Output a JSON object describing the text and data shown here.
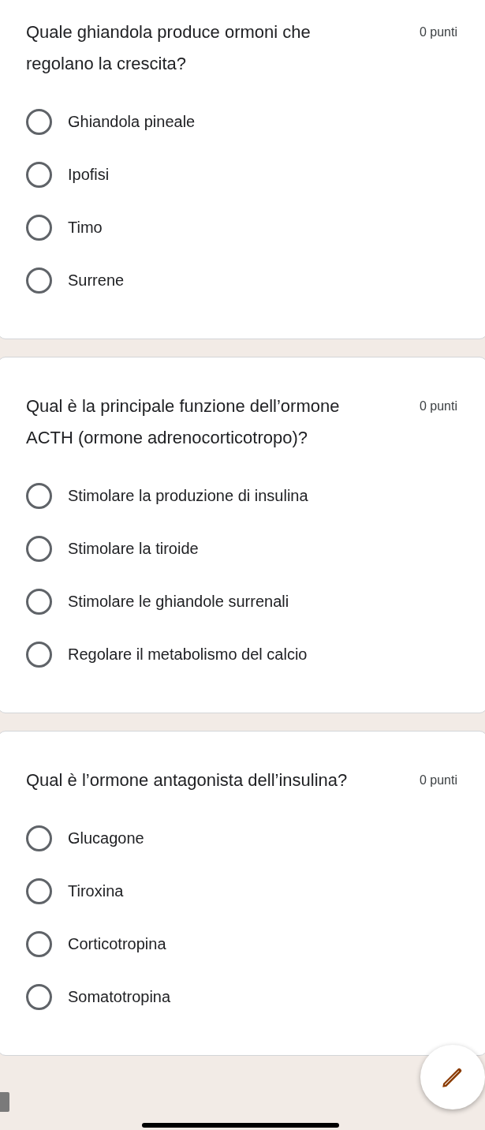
{
  "questions": [
    {
      "title": "Quale ghiandola produce ormoni che regolano la crescita?",
      "points": "0 punti",
      "options": [
        {
          "label": "Ghiandola pineale",
          "selected": false
        },
        {
          "label": "Ipofisi",
          "selected": false
        },
        {
          "label": "Timo",
          "selected": false
        },
        {
          "label": "Surrene",
          "selected": false
        }
      ]
    },
    {
      "title": "Qual è la principale funzione dell’ormone ACTH (ormone adrenocorticotropo)?",
      "points": "0 punti",
      "options": [
        {
          "label": "Stimolare la produzione di insulina",
          "selected": false
        },
        {
          "label": "Stimolare la tiroide",
          "selected": false
        },
        {
          "label": "Stimolare le ghiandole surrenali",
          "selected": false
        },
        {
          "label": "Regolare il metabolismo del calcio",
          "selected": false
        }
      ]
    },
    {
      "title": "Qual è l’ormone antagonista dell’insulina?",
      "points": "0 punti",
      "options": [
        {
          "label": "Glucagone",
          "selected": false
        },
        {
          "label": "Tiroxina",
          "selected": false
        },
        {
          "label": "Corticotropina",
          "selected": false
        },
        {
          "label": "Somatotropina",
          "selected": false
        }
      ]
    }
  ]
}
